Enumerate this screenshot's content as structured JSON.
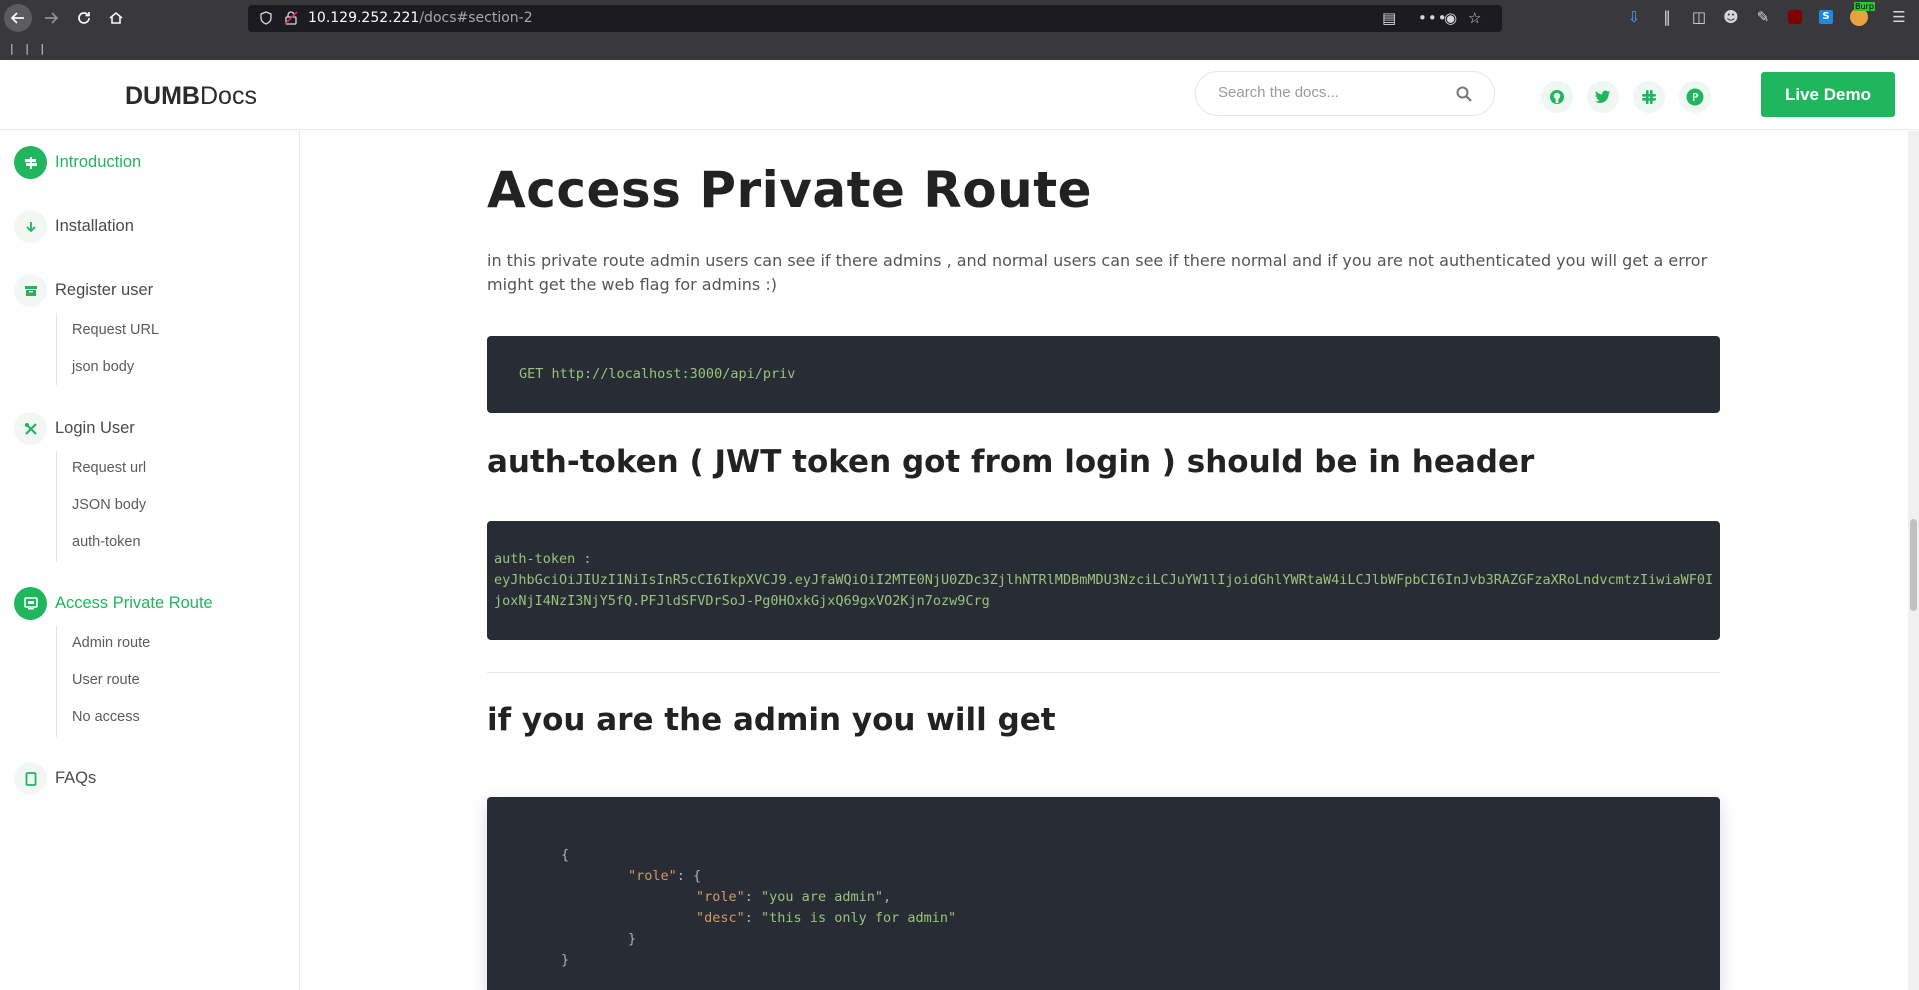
{
  "browser": {
    "url_host": "10.129.252.221",
    "url_path": "/docs#section-2",
    "extension_badge": "Burp"
  },
  "site": {
    "logo_bold": "DUMB",
    "logo_light": "Docs",
    "search_placeholder": "Search the docs...",
    "live_demo_label": "Live Demo",
    "brand_color": "#1fb65d",
    "social_icons": [
      "github-icon",
      "twitter-icon",
      "slack-icon",
      "product-hunt-icon"
    ]
  },
  "sidebar": {
    "sections": [
      {
        "label": "Introduction",
        "icon": "map-signs-icon",
        "active": true
      },
      {
        "label": "Installation",
        "icon": "arrow-down-icon",
        "active": false
      },
      {
        "label": "Register user",
        "icon": "box-icon",
        "active": false,
        "items": [
          "Request URL",
          "json body"
        ]
      },
      {
        "label": "Login User",
        "icon": "tools-icon",
        "active": false,
        "items": [
          "Request url",
          "JSON body",
          "auth-token"
        ]
      },
      {
        "label": "Access Private Route",
        "icon": "screen-icon",
        "active": true,
        "items": [
          "Admin route",
          "User route",
          "No access"
        ]
      },
      {
        "label": "FAQs",
        "icon": "tablet-icon",
        "active": false
      }
    ]
  },
  "main": {
    "title": "Access Private Route",
    "intro": "in this private route admin users can see if there admins , and normal users can see if there normal and if you are not authenticated you will get a error might get the web flag for admins :)",
    "request_code": "GET http://localhost:3000/api/priv",
    "auth_heading": "auth-token ( JWT token got from login ) should be in header",
    "auth_label": "auth-token :",
    "auth_token": "eyJhbGciOiJIUzI1NiIsInR5cCI6IkpXVCJ9.eyJfaWQiOiI2MTE0NjU0ZDc3ZjlhNTRlMDBmMDU3NzciLCJuYW1lIjoidGhlYWRtaW4iLCJlbWFpbCI6InJvb3RAZGFzaXRoLndvcmtzIiwiaWF0IjoxNjI4NzI3NjY5fQ.PFJldSFVDrSoJ-Pg0HOxkGjxQ69gxVO2Kjn7ozw9Crg",
    "admin_heading": "if you are the admin you will get",
    "json_response": {
      "open_brace": "{",
      "outer_key": "\"role\"",
      "inner_role_key": "\"role\"",
      "inner_role_value": "\"you are admin\"",
      "inner_desc_key": "\"desc\"",
      "inner_desc_value": "\"this is only for admin\"",
      "close_inner": "}",
      "close_brace": "}"
    }
  }
}
